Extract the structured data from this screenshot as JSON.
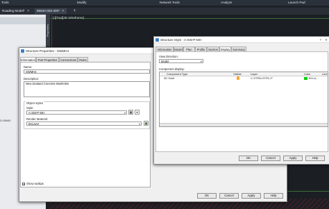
{
  "ribbon": {
    "items": [
      "Tools",
      "Modify",
      "Network Tools",
      "Analyze",
      "Launch Pad"
    ]
  },
  "doc_tabs": [
    {
      "label": "Roading Model*"
    },
    {
      "label": "85832-003-400*"
    }
  ],
  "viewport": {
    "label": "[-][Top][2D Wireframe]",
    "properties_tab": "Properties",
    "coord": "D-95600"
  },
  "structure_properties": {
    "title": "Structure Properties - SWMH4",
    "tabs": [
      "Information",
      "Part Properties",
      "Connections",
      "Rules"
    ],
    "name_label": "Name:",
    "name_value": "SWMH4",
    "description_label": "Description:",
    "description_value": "New Zealand Concrete Manholes",
    "object_styles_label": "Object styles",
    "style_label": "Style:",
    "style_value": "A-SW-P-MH",
    "render_label": "Render Material:",
    "render_value": "ByLayer",
    "show_tooltips": "Show tooltips",
    "buttons": {
      "ok": "OK",
      "cancel": "Cancel",
      "apply": "Apply",
      "help": "Help"
    }
  },
  "structure_style": {
    "title": "Structure Style - A-SW-P-MH",
    "tabs": [
      "Information",
      "Model",
      "Plan",
      "Profile",
      "Section",
      "Display",
      "Summary"
    ],
    "view_direction_label": "View Direction:",
    "view_direction_value": "Model",
    "component_display_label": "Component display:",
    "columns": [
      "Component Type",
      "Visible",
      "Layer",
      "Color",
      "Line"
    ],
    "rows": [
      {
        "type": "3D Solid",
        "layer": "C-STRM-STRC-P",
        "color": "BYLA..."
      }
    ],
    "buttons": {
      "ok": "OK",
      "cancel": "Cancel",
      "apply": "Apply",
      "help": "Help"
    },
    "colors": {
      "swatch": "#00cc00",
      "bulb": "#f5a623"
    }
  }
}
